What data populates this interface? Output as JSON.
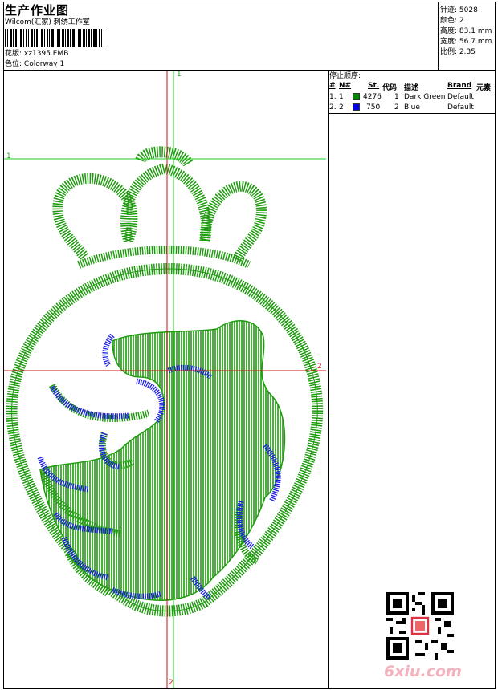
{
  "header": {
    "title": "生产作业图",
    "company": "Wilcom(汇家) 刺绣工作室",
    "design_label": "花版:",
    "design_value": "xz1395.EMB",
    "colorway_label": "色位:",
    "colorway_value": "Colorway 1"
  },
  "stats": [
    {
      "label": "针迹:",
      "value": "5028"
    },
    {
      "label": "颜色:",
      "value": "2"
    },
    {
      "label": "高度:",
      "value": "83.1 mm"
    },
    {
      "label": "宽度:",
      "value": "56.7 mm"
    },
    {
      "label": "比例:",
      "value": "2.35"
    }
  ],
  "stop_sequence": {
    "title": "停止顺序:",
    "columns": [
      "#",
      "N#",
      "St.",
      "代码",
      "描述",
      "Brand",
      "元素"
    ],
    "rows": [
      {
        "index": "1.",
        "n": "1",
        "stitches": "4276",
        "code": "1",
        "desc": "Dark Green",
        "brand": "Default",
        "color": "#008a00"
      },
      {
        "index": "2.",
        "n": "2",
        "stitches": "750",
        "code": "2",
        "desc": "Blue",
        "brand": "Default",
        "color": "#0000e0"
      }
    ]
  },
  "guides": {
    "top": "1",
    "left": "1",
    "right": "2",
    "bottom": "2"
  },
  "colors": {
    "green": "#1e9b0e",
    "blue": "#1a1ae6",
    "guide_red": "#d01010",
    "guide_green": "#22cc22"
  },
  "watermark": "6xiu.com"
}
